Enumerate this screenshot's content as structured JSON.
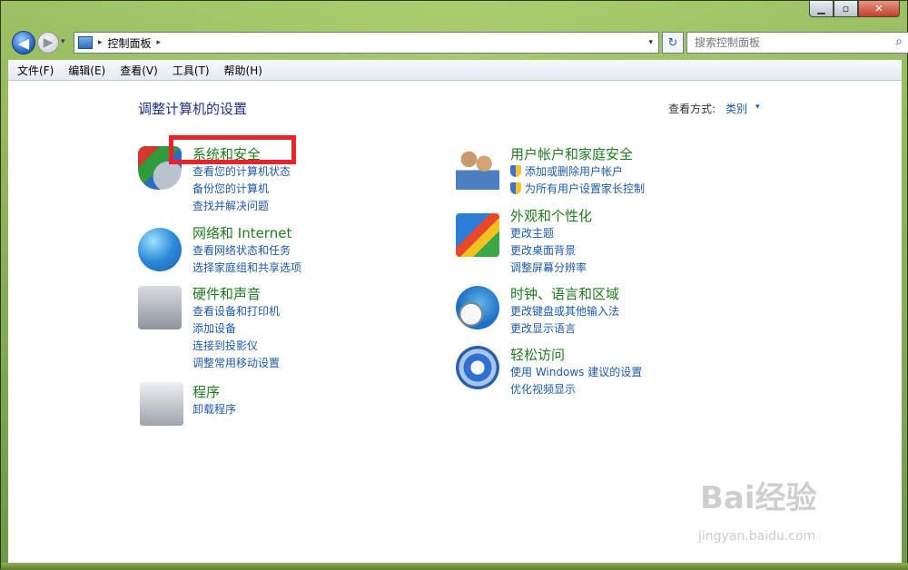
{
  "window": {
    "caption_buttons": [
      {
        "name": "minimize",
        "glyph": "▁"
      },
      {
        "name": "maximize",
        "glyph": "▫"
      },
      {
        "name": "close",
        "glyph": "✕"
      }
    ]
  },
  "nav": {
    "back_glyph": "◀",
    "forward_glyph": "▶",
    "history_glyph": "▾",
    "address_separator": "▸",
    "address": "控制面板",
    "address_separator2": "▸",
    "address_dropdown": "▾",
    "refresh_glyph": "↻",
    "search_placeholder": "搜索控制面板",
    "search_glyph": "⌕"
  },
  "menu": [
    "文件(F)",
    "编辑(E)",
    "查看(V)",
    "工具(T)",
    "帮助(H)"
  ],
  "main": {
    "heading": "调整计算机的设置",
    "view_by_label": "查看方式:",
    "view_by_value": "类别",
    "view_by_arrow": "▾"
  },
  "categories": {
    "security": {
      "title": "系统和安全",
      "links": [
        "查看您的计算机状态",
        "备份您的计算机",
        "查找并解决问题"
      ]
    },
    "network": {
      "title": "网络和 Internet",
      "links": [
        "查看网络状态和任务",
        "选择家庭组和共享选项"
      ]
    },
    "hardware": {
      "title": "硬件和声音",
      "links": [
        "查看设备和打印机",
        "添加设备",
        "连接到投影仪",
        "调整常用移动设置"
      ]
    },
    "programs": {
      "title": "程序",
      "links": [
        "卸载程序"
      ]
    },
    "users": {
      "title": "用户帐户和家庭安全",
      "links": [
        "添加或删除用户帐户",
        "为所有用户设置家长控制"
      ]
    },
    "appearance": {
      "title": "外观和个性化",
      "links": [
        "更改主题",
        "更改桌面背景",
        "调整屏幕分辨率"
      ]
    },
    "clock": {
      "title": "时钟、语言和区域",
      "links": [
        "更改键盘或其他输入法",
        "更改显示语言"
      ]
    },
    "access": {
      "title": "轻松访问",
      "links": [
        "使用 Windows 建议的设置",
        "优化视频显示"
      ]
    }
  },
  "watermark": {
    "text": "Bai经验",
    "sub": "jingyan.baidu.com"
  },
  "colors": {
    "highlight": "#e8232b",
    "link": "#1e5aa8",
    "category_title": "#1e7b1e",
    "heading": "#1e3287"
  }
}
